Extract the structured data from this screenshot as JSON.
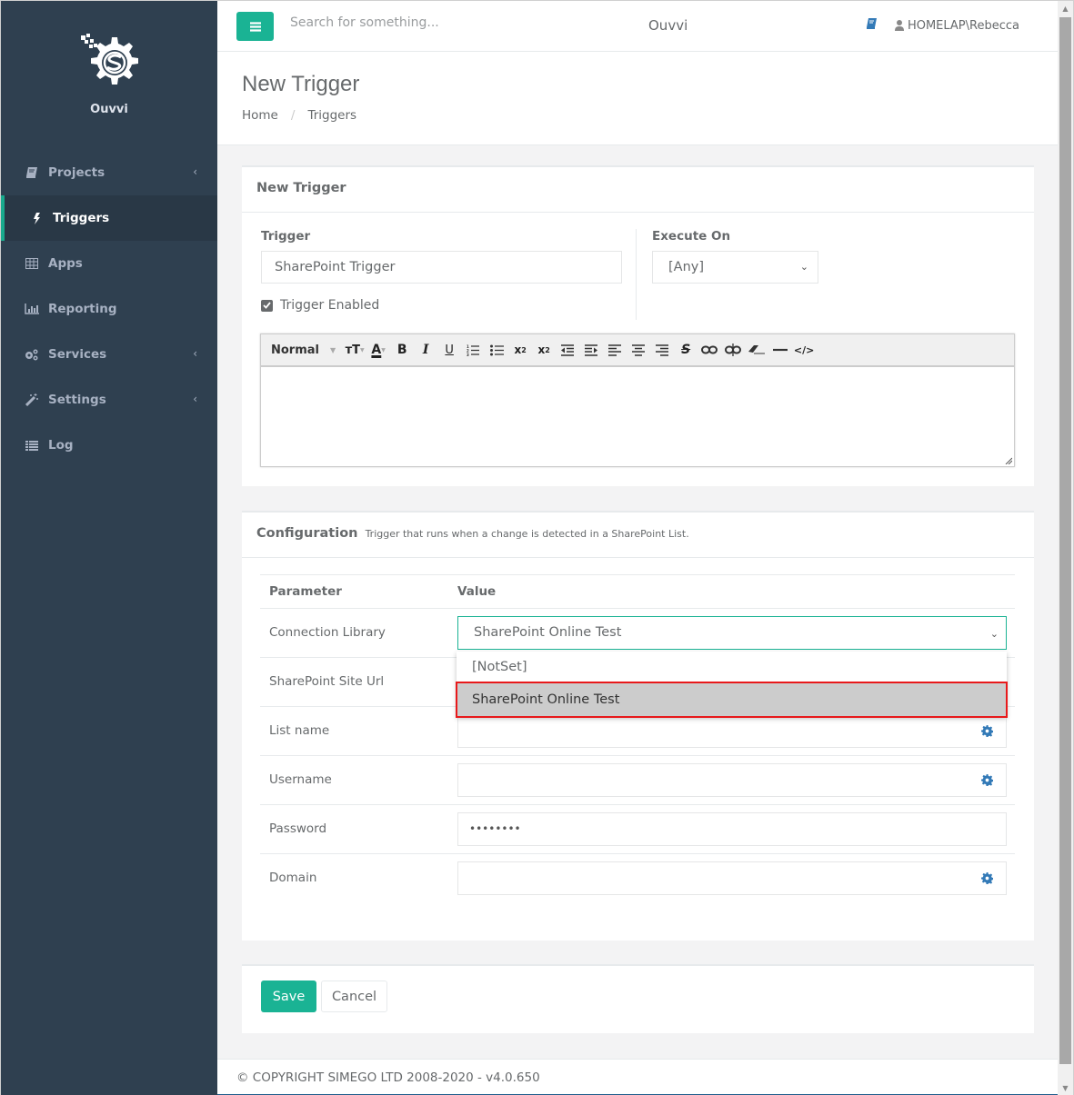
{
  "app": {
    "name": "Ouvvi"
  },
  "sidebar": {
    "items": [
      {
        "label": "Projects",
        "icon": "book-icon",
        "has_children": true,
        "active": false
      },
      {
        "label": "Triggers",
        "icon": "bolt-icon",
        "has_children": false,
        "active": true
      },
      {
        "label": "Apps",
        "icon": "table-icon",
        "has_children": false,
        "active": false
      },
      {
        "label": "Reporting",
        "icon": "bar-chart-icon",
        "has_children": false,
        "active": false
      },
      {
        "label": "Services",
        "icon": "cogs-icon",
        "has_children": true,
        "active": false
      },
      {
        "label": "Settings",
        "icon": "magic-wand-icon",
        "has_children": true,
        "active": false
      },
      {
        "label": "Log",
        "icon": "list-icon",
        "has_children": false,
        "active": false
      }
    ]
  },
  "topbar": {
    "search_placeholder": "Search for something...",
    "title": "Ouvvi",
    "user": "HOMELAP\\Rebecca"
  },
  "page": {
    "title": "New Trigger",
    "breadcrumb": [
      "Home",
      "Triggers"
    ]
  },
  "trigger_panel": {
    "title": "New Trigger",
    "trigger_label": "Trigger",
    "trigger_value": "SharePoint Trigger",
    "execute_on_label": "Execute On",
    "execute_on_value": "[Any]",
    "enabled_label": "Trigger Enabled",
    "enabled": true,
    "editor": {
      "format_label": "Normal",
      "content": ""
    }
  },
  "config_panel": {
    "title": "Configuration",
    "subtitle": "Trigger that runs when a change is detected in a SharePoint List.",
    "col_parameter": "Parameter",
    "col_value": "Value",
    "rows": [
      {
        "name": "Connection Library",
        "value": "SharePoint Online Test",
        "type": "select"
      },
      {
        "name": "SharePoint Site Url",
        "value": "",
        "type": "text"
      },
      {
        "name": "List name",
        "value": "",
        "type": "text-addon"
      },
      {
        "name": "Username",
        "value": "",
        "type": "text-addon"
      },
      {
        "name": "Password",
        "value": "••••••••",
        "type": "password"
      },
      {
        "name": "Domain",
        "value": "",
        "type": "text-addon"
      }
    ],
    "dropdown_options": [
      "[NotSet]",
      "SharePoint Online Test"
    ],
    "dropdown_highlighted": "SharePoint Online Test"
  },
  "actions": {
    "save": "Save",
    "cancel": "Cancel"
  },
  "footer": {
    "copyright": "© COPYRIGHT SIMEGO LTD 2008-2020 - v4.0.650"
  },
  "colors": {
    "accent": "#1ab394",
    "sidebar": "#2f4050",
    "highlight_border": "#e8191b",
    "link_icon": "#337ab7"
  }
}
